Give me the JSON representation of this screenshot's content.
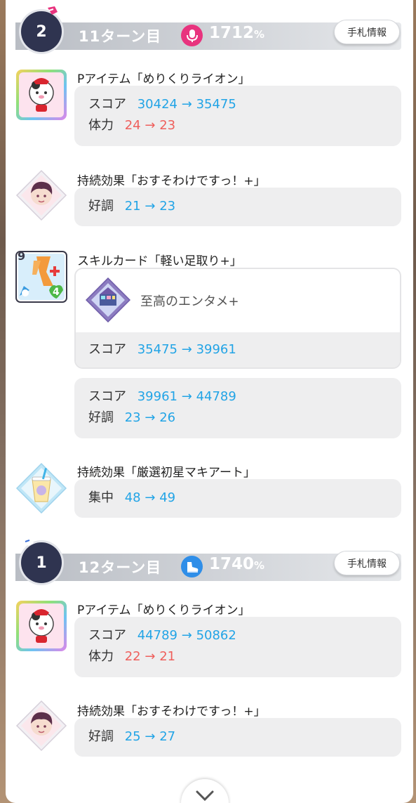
{
  "turns": [
    {
      "number": "2",
      "label": "11ターン目",
      "percent": "1712",
      "percent_unit": "%",
      "icon": "microphone-icon",
      "icon_color": "#e8337e",
      "hand_button": "手札情報"
    },
    {
      "number": "1",
      "label": "12ターン目",
      "percent": "1740",
      "percent_unit": "%",
      "icon": "shoe-icon",
      "icon_color": "#2f8ee8",
      "hand_button": "手札情報"
    }
  ],
  "entries": [
    {
      "title": "Pアイテム「めりくりライオン」",
      "icon": "lion-mascot-icon",
      "stats": [
        {
          "name": "スコア",
          "from": "30424",
          "arrow": "→",
          "to": "35475",
          "color": "blue"
        },
        {
          "name": "体力",
          "from": "24",
          "arrow": "→",
          "to": "23",
          "color": "red"
        }
      ]
    },
    {
      "title": "持続効果「おすそわけですっ！+」",
      "icon": "idol-portrait-icon",
      "stats": [
        {
          "name": "好調",
          "from": "21",
          "arrow": "→",
          "to": "23",
          "color": "blue"
        }
      ]
    },
    {
      "title": "スキルカード「軽い足取り+」",
      "icon": "skill-card-footsteps-icon",
      "card_level": "9",
      "card_cost": "4",
      "sub_card": {
        "name": "至高のエンタメ+",
        "icon": "stage-gem-icon"
      },
      "sub_stats": [
        {
          "name": "スコア",
          "from": "35475",
          "arrow": "→",
          "to": "39961",
          "color": "blue"
        }
      ],
      "stats": [
        {
          "name": "スコア",
          "from": "39961",
          "arrow": "→",
          "to": "44789",
          "color": "blue"
        },
        {
          "name": "好調",
          "from": "23",
          "arrow": "→",
          "to": "26",
          "color": "blue"
        }
      ]
    },
    {
      "title": "持続効果「厳選初星マキアート」",
      "icon": "macchiato-drink-icon",
      "stats": [
        {
          "name": "集中",
          "from": "48",
          "arrow": "→",
          "to": "49",
          "color": "blue"
        }
      ]
    },
    {
      "title": "Pアイテム「めりくりライオン」",
      "icon": "lion-mascot-icon",
      "stats": [
        {
          "name": "スコア",
          "from": "44789",
          "arrow": "→",
          "to": "50862",
          "color": "blue"
        },
        {
          "name": "体力",
          "from": "22",
          "arrow": "→",
          "to": "21",
          "color": "red"
        }
      ]
    },
    {
      "title": "持続効果「おすそわけですっ！+」",
      "icon": "idol-portrait-icon",
      "stats": [
        {
          "name": "好調",
          "from": "25",
          "arrow": "→",
          "to": "27",
          "color": "blue"
        }
      ]
    }
  ],
  "footer": {
    "icon": "chevron-down-icon"
  }
}
